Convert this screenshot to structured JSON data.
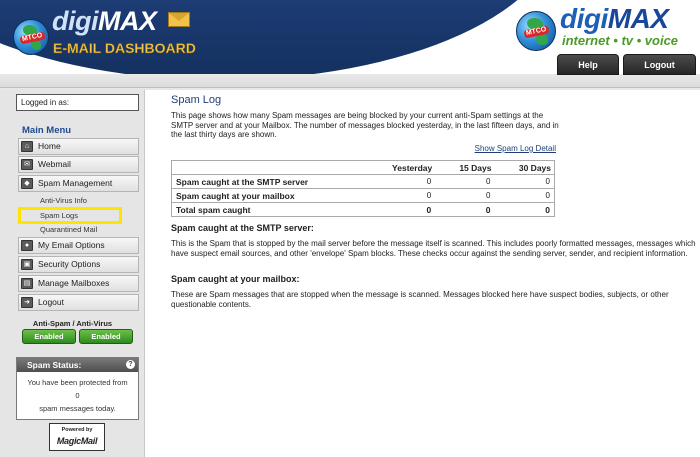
{
  "header": {
    "logo_left_name_a": "digi",
    "logo_left_name_b": "MAX",
    "logo_left_sub": "E-MAIL DASHBOARD",
    "logo_badge": "MTCO",
    "logo_right_name_a": "digi",
    "logo_right_name_b": "MAX",
    "logo_right_tag": "internet • tv • voice",
    "help_label": "Help",
    "logout_label": "Logout"
  },
  "sidebar": {
    "logged_in_label": "Logged in as:",
    "menu_title": "Main Menu",
    "items": [
      {
        "label": "Home",
        "icon": "home-icon"
      },
      {
        "label": "Webmail",
        "icon": "envelope-icon"
      },
      {
        "label": "Spam Management",
        "icon": "shield-icon"
      },
      {
        "label": "My Email Options",
        "icon": "user-icon"
      },
      {
        "label": "Security Options",
        "icon": "lock-icon"
      },
      {
        "label": "Manage Mailboxes",
        "icon": "mailbox-icon"
      },
      {
        "label": "Logout",
        "icon": "exit-icon"
      }
    ],
    "sub_items": [
      "Anti-Virus Info",
      "Spam Logs",
      "Quarantined Mail"
    ],
    "antivirus_title": "Anti-Spam / Anti-Virus",
    "antispam_state": "Enabled",
    "antivirus_state": "Enabled",
    "status": {
      "title": "Spam Status:",
      "help_glyph": "?",
      "line1": "You have been protected from",
      "count": "0",
      "line2": "spam messages today."
    },
    "powered_by": "Powered by",
    "powered_brand": "MagicMail"
  },
  "main": {
    "title": "Spam Log",
    "intro": "This page shows how many Spam messages are being blocked by your current anti-Spam settings at the SMTP server and at your Mailbox. The number of messages blocked yesterday, in the last fifteen days, and in the last thirty days are shown.",
    "detail_link": "Show Spam Log Detail",
    "table": {
      "headers": [
        "Yesterday",
        "15 Days",
        "30 Days"
      ],
      "rows": [
        {
          "label": "Spam caught at the SMTP server",
          "values": [
            "0",
            "0",
            "0"
          ]
        },
        {
          "label": "Spam caught at your mailbox",
          "values": [
            "0",
            "0",
            "0"
          ]
        },
        {
          "label": "Total spam caught",
          "values": [
            "0",
            "0",
            "0"
          ]
        }
      ]
    },
    "section1_title": "Spam caught at the SMTP server:",
    "section1_text": "This is the Spam that is stopped by the mail server before the message itself is scanned. This includes poorly formatted messages, messages which have suspect email sources, and other 'envelope' Spam blocks. These checks occur against the sending server, sender, and recipient information.",
    "section2_title": "Spam caught at your mailbox:",
    "section2_text": "These are Spam messages that are stopped when the message is scanned. Messages blocked here have suspect bodies, subjects, or other questionable contents."
  },
  "colors": {
    "header_blue": "#1e3e78",
    "title_blue": "#1f3e78",
    "enabled_green": "#2f8b1f",
    "highlight_yellow": "#ffe400",
    "sidebar_bg": "#e5e5e5"
  }
}
